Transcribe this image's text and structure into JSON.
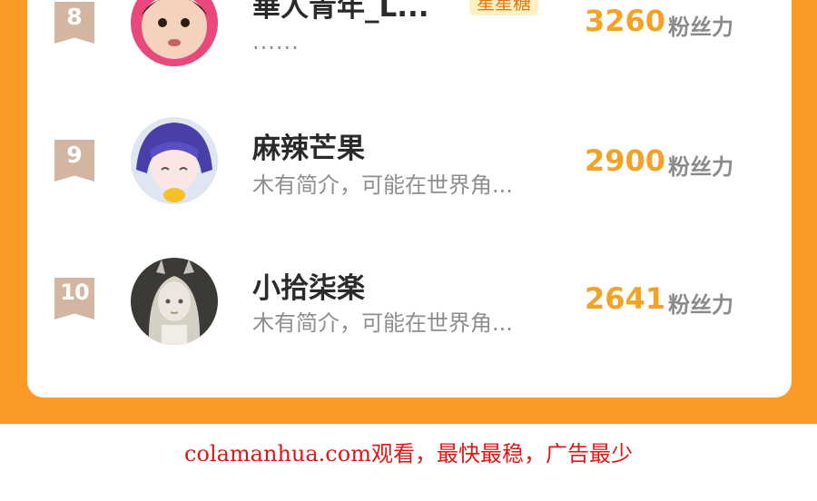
{
  "ranking": {
    "entries": [
      {
        "rank": "8",
        "name": "華人青年_L...",
        "tag": "星星糖",
        "desc": "......",
        "fans": "3260",
        "unit": "粉丝力"
      },
      {
        "rank": "9",
        "name": "麻辣芒果",
        "tag": "",
        "desc": "木有简介，可能在世界角...",
        "fans": "2900",
        "unit": "粉丝力"
      },
      {
        "rank": "10",
        "name": "小拾柒楽",
        "tag": "",
        "desc": "木有简介，可能在世界角...",
        "fans": "2641",
        "unit": "粉丝力"
      }
    ]
  },
  "footer": {
    "text": "colamanhua.com观看，最快最稳，广告最少"
  },
  "colors": {
    "accent": "#fb9b26",
    "fans": "#f2a325",
    "badge": "#d2b6a1",
    "footer": "#e01717"
  },
  "icons": [
    "rank-ribbon-icon"
  ]
}
